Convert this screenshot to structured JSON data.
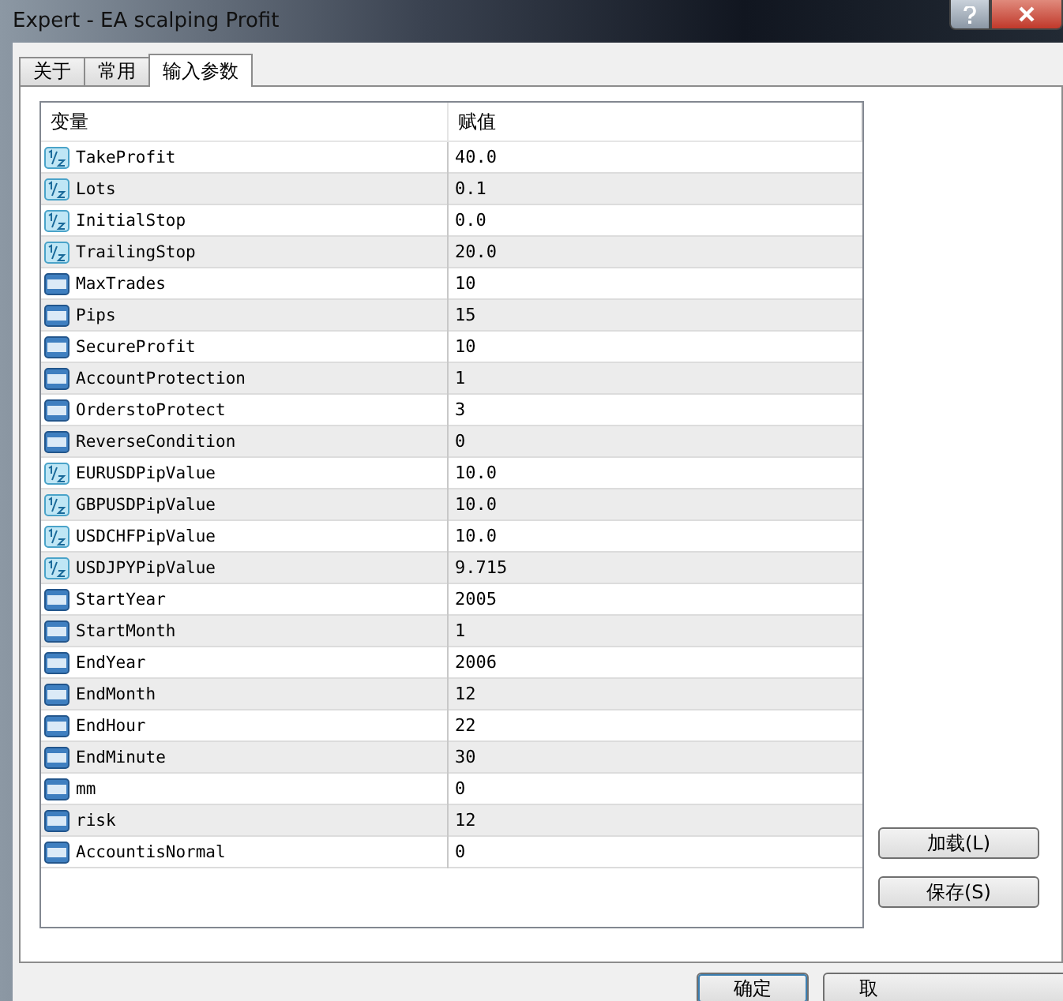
{
  "window": {
    "title": "Expert - EA scalping Profit"
  },
  "tabs": [
    {
      "label": "关于",
      "selected": false
    },
    {
      "label": "常用",
      "selected": false
    },
    {
      "label": "输入参数",
      "selected": true
    }
  ],
  "table": {
    "columns": [
      "变量",
      "赋值"
    ],
    "rows": [
      {
        "kind": "double",
        "name": "TakeProfit",
        "value": "40.0"
      },
      {
        "kind": "double",
        "name": "Lots",
        "value": "0.1"
      },
      {
        "kind": "double",
        "name": "InitialStop",
        "value": "0.0"
      },
      {
        "kind": "double",
        "name": "TrailingStop",
        "value": "20.0"
      },
      {
        "kind": "int",
        "name": "MaxTrades",
        "value": "10"
      },
      {
        "kind": "int",
        "name": "Pips",
        "value": "15"
      },
      {
        "kind": "int",
        "name": "SecureProfit",
        "value": "10"
      },
      {
        "kind": "int",
        "name": "AccountProtection",
        "value": "1"
      },
      {
        "kind": "int",
        "name": "OrderstoProtect",
        "value": "3"
      },
      {
        "kind": "int",
        "name": "ReverseCondition",
        "value": "0"
      },
      {
        "kind": "double",
        "name": "EURUSDPipValue",
        "value": "10.0"
      },
      {
        "kind": "double",
        "name": "GBPUSDPipValue",
        "value": "10.0"
      },
      {
        "kind": "double",
        "name": "USDCHFPipValue",
        "value": "10.0"
      },
      {
        "kind": "double",
        "name": "USDJPYPipValue",
        "value": "9.715"
      },
      {
        "kind": "int",
        "name": "StartYear",
        "value": "2005"
      },
      {
        "kind": "int",
        "name": "StartMonth",
        "value": "1"
      },
      {
        "kind": "int",
        "name": "EndYear",
        "value": "2006"
      },
      {
        "kind": "int",
        "name": "EndMonth",
        "value": "12"
      },
      {
        "kind": "int",
        "name": "EndHour",
        "value": "22"
      },
      {
        "kind": "int",
        "name": "EndMinute",
        "value": "30"
      },
      {
        "kind": "int",
        "name": "mm",
        "value": "0"
      },
      {
        "kind": "int",
        "name": "risk",
        "value": "12"
      },
      {
        "kind": "int",
        "name": "AccountisNormal",
        "value": "0"
      }
    ]
  },
  "side_buttons": [
    "加载(L)",
    "保存(S)"
  ],
  "bottom_buttons": [
    "确定",
    "取"
  ]
}
